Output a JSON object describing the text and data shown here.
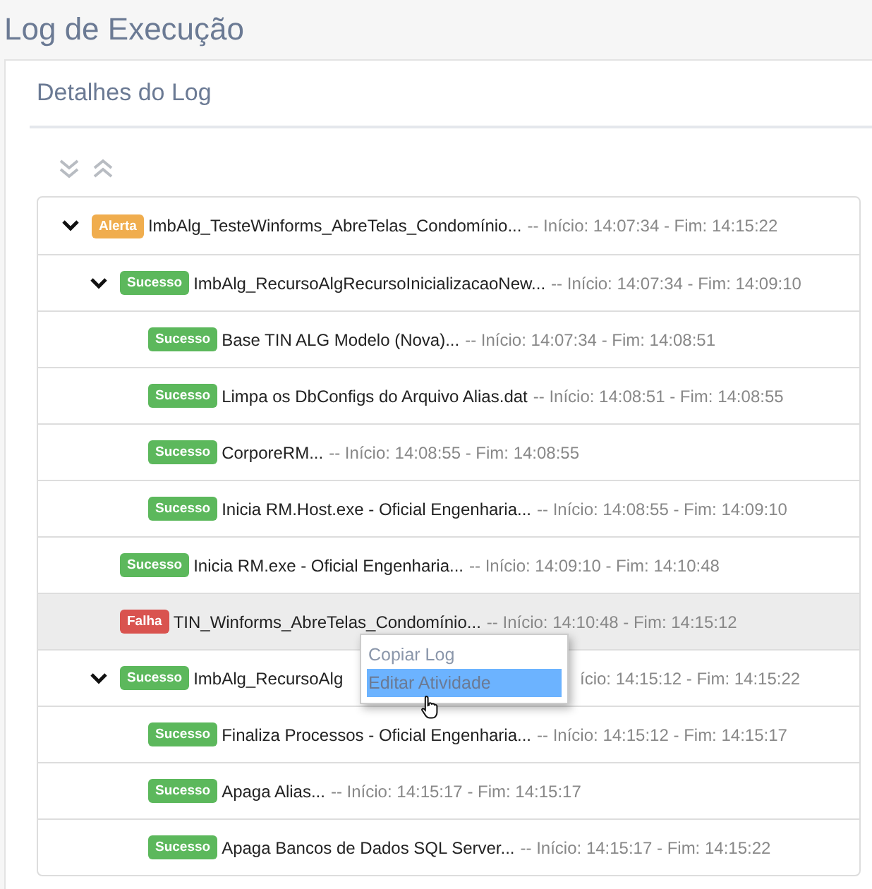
{
  "page_title": "Log de Execução",
  "panel": {
    "title": "Detalhes do Log",
    "toolbar": [
      {
        "kind": "expand-all"
      },
      {
        "kind": "collapse-all"
      }
    ],
    "tree": [
      {
        "badge": {
          "label": "Alerta",
          "kind": "warning"
        },
        "name": "ImbAlg_TesteWinforms_AbreTelas_Condomínio...",
        "times": "-- Início: 14:07:34 - Fim: 14:15:22",
        "expanded": true,
        "selected": false,
        "covered": false,
        "children": [
          {
            "badge": {
              "label": "Sucesso",
              "kind": "success"
            },
            "name": "ImbAlg_RecursoAlgRecursoInicializacaoNew...",
            "times": "-- Início: 14:07:34 - Fim: 14:09:10",
            "expanded": true,
            "selected": false,
            "covered": false,
            "children": [
              {
                "badge": {
                  "label": "Sucesso",
                  "kind": "success"
                },
                "name": "Base TIN ALG Modelo (Nova)...",
                "times": "-- Início: 14:07:34 - Fim: 14:08:51",
                "selected": false,
                "covered": false
              },
              {
                "badge": {
                  "label": "Sucesso",
                  "kind": "success"
                },
                "name": "Limpa os DbConfigs do Arquivo Alias.dat",
                "times": "-- Início: 14:08:51 - Fim: 14:08:55",
                "selected": false,
                "covered": false
              },
              {
                "badge": {
                  "label": "Sucesso",
                  "kind": "success"
                },
                "name": "CorporeRM...",
                "times": "-- Início: 14:08:55 - Fim: 14:08:55",
                "selected": false,
                "covered": false
              },
              {
                "badge": {
                  "label": "Sucesso",
                  "kind": "success"
                },
                "name": "Inicia RM.Host.exe - Oficial Engenharia...",
                "times": "-- Início: 14:08:55 - Fim: 14:09:10",
                "selected": false,
                "covered": false
              }
            ]
          },
          {
            "badge": {
              "label": "Sucesso",
              "kind": "success"
            },
            "name": "Inicia RM.exe - Oficial Engenharia...",
            "times": "-- Início: 14:09:10 - Fim: 14:10:48",
            "selected": false,
            "covered": false
          },
          {
            "badge": {
              "label": "Falha",
              "kind": "danger"
            },
            "name": "TIN_Winforms_AbreTelas_Condomínio...",
            "times": "-- Início: 14:10:48 - Fim: 14:15:12",
            "selected": true,
            "covered": false,
            "context_menu": [
              {
                "label": "Copiar Log",
                "selected": false
              },
              {
                "label": "Editar Atividade",
                "selected": true
              }
            ]
          },
          {
            "badge": {
              "label": "Sucesso",
              "kind": "success"
            },
            "name": "ImbAlg_RecursoAlg",
            "times": "ício: 14:15:12 - Fim: 14:15:22",
            "expanded": true,
            "selected": false,
            "covered": true,
            "children": [
              {
                "badge": {
                  "label": "Sucesso",
                  "kind": "success"
                },
                "name": "Finaliza Processos - Oficial Engenharia...",
                "times": "-- Início: 14:15:12 - Fim: 14:15:17",
                "selected": false,
                "covered": false
              },
              {
                "badge": {
                  "label": "Sucesso",
                  "kind": "success"
                },
                "name": "Apaga Alias...",
                "times": "-- Início: 14:15:17 - Fim: 14:15:17",
                "selected": false,
                "covered": false
              },
              {
                "badge": {
                  "label": "Sucesso",
                  "kind": "success"
                },
                "name": "Apaga Bancos de Dados SQL Server...",
                "times": "-- Início: 14:15:17 - Fim: 14:15:22",
                "selected": false,
                "covered": false
              }
            ]
          }
        ]
      }
    ]
  }
}
